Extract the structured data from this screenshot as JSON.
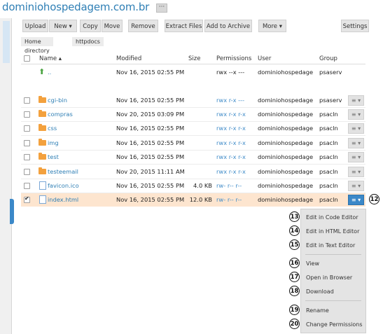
{
  "domain_title": "dominiohospedagem.com.br",
  "more_label": "···",
  "toolbar": {
    "upload": "Upload",
    "new": "New ▾",
    "copy": "Copy",
    "move": "Move",
    "remove": "Remove",
    "extract": "Extract Files",
    "archive": "Add to Archive",
    "more": "More ▾",
    "settings": "Settings"
  },
  "breadcrumb": [
    "Home directory",
    "httpdocs"
  ],
  "columns": {
    "name": "Name ▴",
    "modified": "Modified",
    "size": "Size",
    "permissions": "Permissions",
    "user": "User",
    "group": "Group"
  },
  "parent_row": {
    "name": "..",
    "modified": "Nov 16, 2015 02:55 PM",
    "permissions": "rwx --x ---",
    "user": "dominiohospedage",
    "group": "psaserv"
  },
  "rows": [
    {
      "name": "cgi-bin",
      "type": "folder",
      "modified": "Nov 16, 2015 02:55 PM",
      "size": "",
      "permissions": "rwx r-x ---",
      "user": "dominiohospedage",
      "group": "psaserv"
    },
    {
      "name": "compras",
      "type": "folder",
      "modified": "Nov 20, 2015 03:09 PM",
      "size": "",
      "permissions": "rwx r-x r-x",
      "user": "dominiohospedage",
      "group": "psacln"
    },
    {
      "name": "css",
      "type": "folder",
      "modified": "Nov 16, 2015 02:55 PM",
      "size": "",
      "permissions": "rwx r-x r-x",
      "user": "dominiohospedage",
      "group": "psacln"
    },
    {
      "name": "img",
      "type": "folder",
      "modified": "Nov 16, 2015 02:55 PM",
      "size": "",
      "permissions": "rwx r-x r-x",
      "user": "dominiohospedage",
      "group": "psacln"
    },
    {
      "name": "test",
      "type": "folder",
      "modified": "Nov 16, 2015 02:55 PM",
      "size": "",
      "permissions": "rwx r-x r-x",
      "user": "dominiohospedage",
      "group": "psacln"
    },
    {
      "name": "testeemail",
      "type": "folder",
      "modified": "Nov 20, 2015 11:11 AM",
      "size": "",
      "permissions": "rwx r-x r-x",
      "user": "dominiohospedage",
      "group": "psacln"
    },
    {
      "name": "favicon.ico",
      "type": "file",
      "modified": "Nov 16, 2015 02:55 PM",
      "size": "4.0 KB",
      "permissions": "rw- r-- r--",
      "user": "dominiohospedage",
      "group": "psacln"
    },
    {
      "name": "index.html",
      "type": "file",
      "modified": "Nov 16, 2015 02:55 PM",
      "size": "12.0 KB",
      "permissions": "rw- r-- r--",
      "user": "dominiohospedage",
      "group": "psacln"
    }
  ],
  "menu_button": "≡ ▾",
  "context_menu": {
    "edit_code": "Edit in Code Editor",
    "edit_html": "Edit in HTML Editor",
    "edit_text": "Edit in Text Editor",
    "view": "View",
    "open_browser": "Open in Browser",
    "download": "Download",
    "rename": "Rename",
    "change_perms": "Change Permissions"
  },
  "badges": {
    "b12": "12",
    "b13": "13",
    "b14": "14",
    "b15": "15",
    "b16": "16",
    "b17": "17",
    "b18": "18",
    "b19": "19",
    "b20": "20"
  }
}
